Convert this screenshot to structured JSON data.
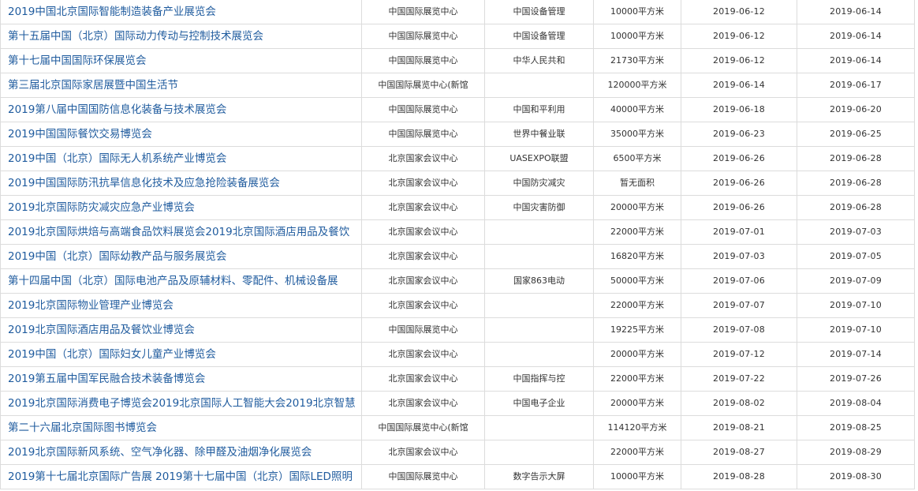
{
  "exhibitions": [
    {
      "name": "2019中国北京国际智能制造装备产业展览会",
      "venue": "中国国际展览中心",
      "organizer": "中国设备管理",
      "area": "10000平方米",
      "start": "2019-06-12",
      "end": "2019-06-14"
    },
    {
      "name": "第十五届中国（北京）国际动力传动与控制技术展览会",
      "venue": "中国国际展览中心",
      "organizer": "中国设备管理",
      "area": "10000平方米",
      "start": "2019-06-12",
      "end": "2019-06-14"
    },
    {
      "name": "第十七届中国国际环保展览会",
      "venue": "中国国际展览中心",
      "organizer": "中华人民共和",
      "area": "21730平方米",
      "start": "2019-06-12",
      "end": "2019-06-14"
    },
    {
      "name": "第三届北京国际家居展暨中国生活节",
      "venue": "中国国际展览中心(新馆",
      "organizer": "",
      "area": "120000平方米",
      "start": "2019-06-14",
      "end": "2019-06-17"
    },
    {
      "name": "2019第八届中国国防信息化装备与技术展览会",
      "venue": "中国国际展览中心",
      "organizer": "中国和平利用",
      "area": "40000平方米",
      "start": "2019-06-18",
      "end": "2019-06-20"
    },
    {
      "name": "2019中国国际餐饮交易博览会",
      "venue": "中国国际展览中心",
      "organizer": "世界中餐业联",
      "area": "35000平方米",
      "start": "2019-06-23",
      "end": "2019-06-25"
    },
    {
      "name": "2019中国（北京）国际无人机系统产业博览会",
      "venue": "北京国家会议中心",
      "organizer": "UASEXPO联盟",
      "area": "6500平方米",
      "start": "2019-06-26",
      "end": "2019-06-28"
    },
    {
      "name": "2019中国国际防汛抗旱信息化技术及应急抢险装备展览会",
      "venue": "北京国家会议中心",
      "organizer": "中国防灾减灾",
      "area": "暂无面积",
      "start": "2019-06-26",
      "end": "2019-06-28"
    },
    {
      "name": "2019北京国际防灾减灾应急产业博览会",
      "venue": "北京国家会议中心",
      "organizer": "中国灾害防御",
      "area": "20000平方米",
      "start": "2019-06-26",
      "end": "2019-06-28"
    },
    {
      "name": "2019北京国际烘焙与高端食品饮料展览会2019北京国际酒店用品及餐饮",
      "venue": "北京国家会议中心",
      "organizer": "",
      "area": "22000平方米",
      "start": "2019-07-01",
      "end": "2019-07-03"
    },
    {
      "name": "2019中国（北京）国际幼教产品与服务展览会",
      "venue": "北京国家会议中心",
      "organizer": "",
      "area": "16820平方米",
      "start": "2019-07-03",
      "end": "2019-07-05"
    },
    {
      "name": "第十四届中国（北京）国际电池产品及原辅材料、零配件、机械设备展",
      "venue": "北京国家会议中心",
      "organizer": "国家863电动",
      "area": "50000平方米",
      "start": "2019-07-06",
      "end": "2019-07-09"
    },
    {
      "name": "2019北京国际物业管理产业博览会",
      "venue": "北京国家会议中心",
      "organizer": "",
      "area": "22000平方米",
      "start": "2019-07-07",
      "end": "2019-07-10"
    },
    {
      "name": "2019北京国际酒店用品及餐饮业博览会",
      "venue": "中国国际展览中心",
      "organizer": "",
      "area": "19225平方米",
      "start": "2019-07-08",
      "end": "2019-07-10"
    },
    {
      "name": "2019中国（北京）国际妇女儿童产业博览会",
      "venue": "北京国家会议中心",
      "organizer": "",
      "area": "20000平方米",
      "start": "2019-07-12",
      "end": "2019-07-14"
    },
    {
      "name": "2019第五届中国军民融合技术装备博览会",
      "venue": "北京国家会议中心",
      "organizer": "中国指挥与控",
      "area": "22000平方米",
      "start": "2019-07-22",
      "end": "2019-07-26"
    },
    {
      "name": "2019北京国际消费电子博览会2019北京国际人工智能大会2019北京智慧",
      "venue": "北京国家会议中心",
      "organizer": "中国电子企业",
      "area": "20000平方米",
      "start": "2019-08-02",
      "end": "2019-08-04"
    },
    {
      "name": "第二十六届北京国际图书博览会",
      "venue": "中国国际展览中心(新馆",
      "organizer": "",
      "area": "114120平方米",
      "start": "2019-08-21",
      "end": "2019-08-25"
    },
    {
      "name": "2019北京国际新风系统、空气净化器、除甲醛及油烟净化展览会",
      "venue": "北京国家会议中心",
      "organizer": "",
      "area": "22000平方米",
      "start": "2019-08-27",
      "end": "2019-08-29"
    },
    {
      "name": "2019第十七届北京国际广告展 2019第十七届中国（北京）国际LED照明",
      "venue": "中国国际展览中心",
      "organizer": "数字告示大屏",
      "area": "10000平方米",
      "start": "2019-08-28",
      "end": "2019-08-30"
    }
  ],
  "colors": {
    "link": "#1f5b9e",
    "text": "#333333",
    "border": "#dcdcdc"
  }
}
